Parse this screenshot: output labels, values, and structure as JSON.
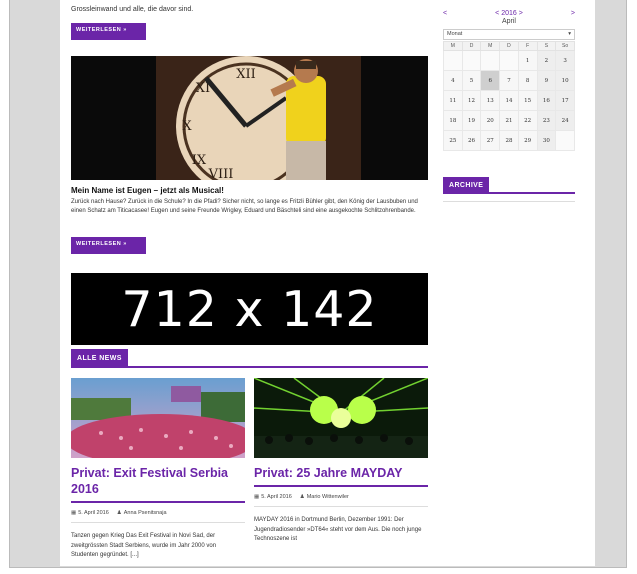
{
  "intro": {
    "text": "Grossleinwand und alle, die davor sind."
  },
  "buttons": {
    "read_more_1": "WEITERLESEN »",
    "read_more_2": "WEITERLESEN »"
  },
  "article": {
    "title": "Mein Name ist Eugen – jetzt als Musical!",
    "text": "Zurück nach Hause? Zurück in die Schule? In die Pfadi? Sicher nicht, so lange es Fritzli Bühler gibt, den König der Lausbuben und einen Schatz am Titicacasee! Eugen und seine Freunde Wrigley, Eduard und Bäschteli sind eine ausgekochte Schlitzohrenbande."
  },
  "ad_banner": {
    "text": "712 x 142"
  },
  "section": {
    "all_news": "ALLE NEWS"
  },
  "news": [
    {
      "title": "Privat: Exit Festival Serbia 2016",
      "date": "5. April 2016",
      "author": "Anna Psenitsnaja",
      "text": "Tanzen gegen Krieg Das Exit Festival in Novi Sad, der zweitgrössten Stadt Serbiens, wurde im Jahr 2000 von Studenten gegründet. [...]"
    },
    {
      "title": "Privat: 25 Jahre MAYDAY",
      "date": "5. April 2016",
      "author": "Mario Wittenwiler",
      "text": "MAYDAY 2016 in Dortmund Berlin, Dezember 1991: Der Jugendradiosender »DT64« steht vor dem Aus. Die noch junge Technoszene ist"
    }
  ],
  "calendar": {
    "prev": "<",
    "next": ">",
    "year_prefix": "< 2016 >",
    "month": "April",
    "select_label": "Monat",
    "weekdays": [
      "M",
      "D",
      "M",
      "D",
      "F",
      "S",
      "So"
    ],
    "rows": [
      [
        "",
        "",
        "",
        "",
        "1",
        "2",
        "3"
      ],
      [
        "4",
        "5",
        "6",
        "7",
        "8",
        "9",
        "10"
      ],
      [
        "11",
        "12",
        "13",
        "14",
        "15",
        "16",
        "17"
      ],
      [
        "18",
        "19",
        "20",
        "21",
        "22",
        "23",
        "24"
      ],
      [
        "25",
        "26",
        "27",
        "28",
        "29",
        "30",
        ""
      ]
    ],
    "today": "6"
  },
  "archive": {
    "label": "ARCHIVE"
  },
  "colors": {
    "accent": "#6b25a8"
  }
}
